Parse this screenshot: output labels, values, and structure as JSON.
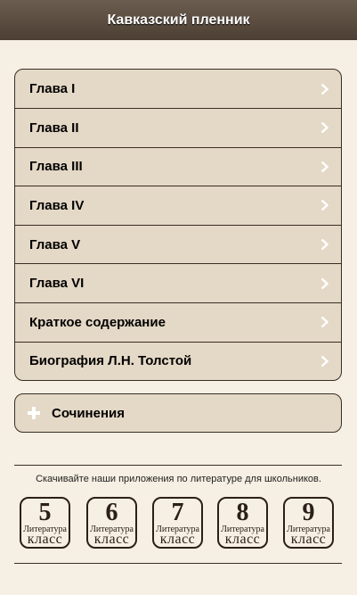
{
  "header": {
    "title": "Кавказский пленник"
  },
  "chapters": [
    {
      "label": "Глава I"
    },
    {
      "label": "Глава II"
    },
    {
      "label": "Глава III"
    },
    {
      "label": "Глава IV"
    },
    {
      "label": "Глава V"
    },
    {
      "label": "Глава VI"
    },
    {
      "label": "Краткое содержание"
    },
    {
      "label": "Биография Л.Н. Толстой"
    }
  ],
  "essays": {
    "label": "Сочинения",
    "icon": "plus-icon"
  },
  "promo": {
    "text": "Скачивайте наши приложения по литературе для школьников.",
    "apps": [
      {
        "number": "5",
        "subject": "Литература",
        "grade_word": "класс"
      },
      {
        "number": "6",
        "subject": "Литература",
        "grade_word": "класс"
      },
      {
        "number": "7",
        "subject": "Литература",
        "grade_word": "класс"
      },
      {
        "number": "8",
        "subject": "Литература",
        "grade_word": "класс"
      },
      {
        "number": "9",
        "subject": "Литература",
        "grade_word": "класс"
      }
    ]
  },
  "colors": {
    "background": "#f6efe3",
    "item_background": "#e4d8c6",
    "header": "#4c3f33",
    "border": "#3a2e24"
  }
}
